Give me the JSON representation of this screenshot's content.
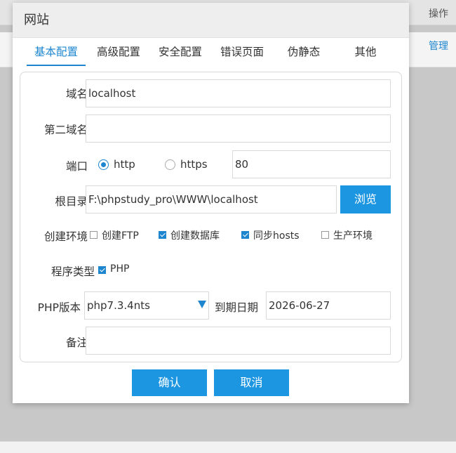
{
  "background": {
    "column_header": "操作",
    "row_action": "管理"
  },
  "dialog": {
    "title": "网站",
    "tabs": [
      {
        "label": "基本配置",
        "active": true
      },
      {
        "label": "高级配置",
        "active": false
      },
      {
        "label": "安全配置",
        "active": false
      },
      {
        "label": "错误页面",
        "active": false
      },
      {
        "label": "伪静态",
        "active": false
      },
      {
        "label": "其他",
        "active": false
      }
    ],
    "form": {
      "domain_label": "域名",
      "domain_value": "localhost",
      "second_domain_label": "第二域名",
      "second_domain_value": "",
      "port_label": "端口",
      "protocol_options": [
        {
          "label": "http",
          "selected": true
        },
        {
          "label": "https",
          "selected": false
        }
      ],
      "port_value": "80",
      "root_label": "根目录",
      "root_value": "F:\\phpstudy_pro\\WWW\\localhost",
      "browse_label": "浏览",
      "env_label": "创建环境",
      "env_options": [
        {
          "label": "创建FTP",
          "checked": false
        },
        {
          "label": "创建数据库",
          "checked": true
        },
        {
          "label": "同步hosts",
          "checked": true
        },
        {
          "label": "生产环境",
          "checked": false
        }
      ],
      "program_type_label": "程序类型",
      "program_type_option": {
        "label": "PHP",
        "checked": true
      },
      "php_version_label": "PHP版本",
      "php_version_value": "php7.3.4nts",
      "expire_label": "到期日期",
      "expire_value": "2026-06-27",
      "note_label": "备注",
      "note_value": ""
    },
    "buttons": {
      "confirm": "确认",
      "cancel": "取消"
    }
  },
  "colors": {
    "accent": "#1d86cf",
    "button": "#1d96e1",
    "overlay": "#c8c8c8"
  }
}
